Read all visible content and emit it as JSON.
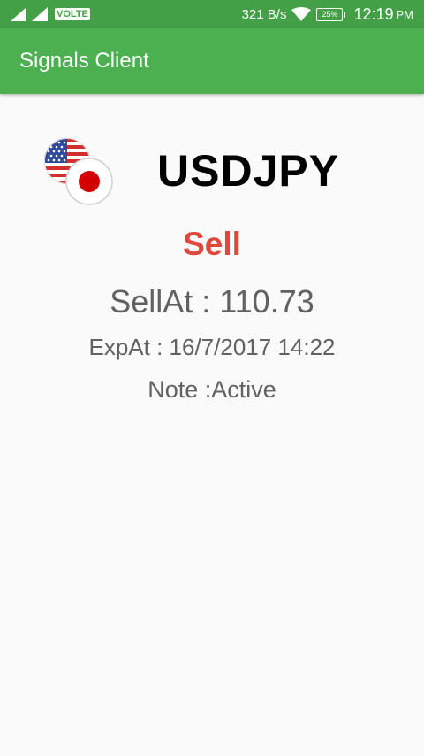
{
  "status_bar": {
    "volte": "VOLTE",
    "net_speed": "321 B/s",
    "battery": "25%",
    "time": "12:19",
    "ampm": "PM"
  },
  "app_bar": {
    "title": "Signals Client"
  },
  "signal": {
    "pair": "USDJPY",
    "flags": [
      "us-flag-icon",
      "japan-flag-icon"
    ],
    "direction": "Sell",
    "price_line": "SellAt : 110.73",
    "expiry_line": "ExpAt : 16/7/2017 14:22",
    "note_line": "Note :Active"
  },
  "colors": {
    "status_bar": "#43a047",
    "app_bar": "#4caf50",
    "sell": "#e0483b",
    "secondary_text": "#616161",
    "background": "#fafafa"
  }
}
